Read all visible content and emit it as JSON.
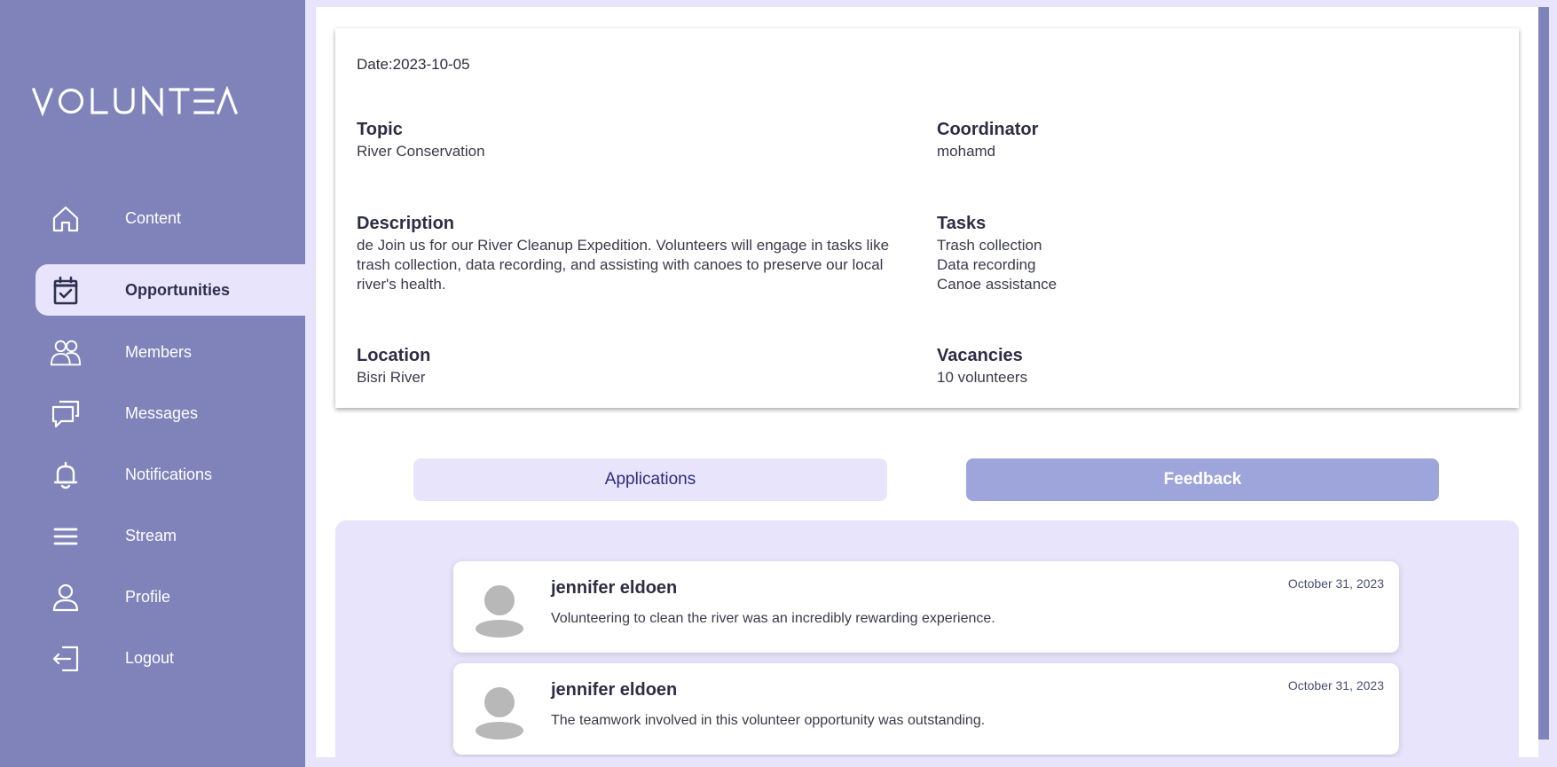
{
  "app": {
    "logo_text": "VOLUNTEA"
  },
  "sidebar": {
    "items": [
      {
        "label": "Content",
        "icon": "home-icon"
      },
      {
        "label": "Opportunities",
        "icon": "calendar-check-icon",
        "active": true
      },
      {
        "label": "Members",
        "icon": "members-icon"
      },
      {
        "label": "Messages",
        "icon": "messages-icon"
      },
      {
        "label": "Notifications",
        "icon": "bell-icon"
      },
      {
        "label": "Stream",
        "icon": "menu-lines-icon"
      },
      {
        "label": "Profile",
        "icon": "user-icon"
      },
      {
        "label": "Logout",
        "icon": "logout-icon"
      }
    ]
  },
  "opportunity": {
    "date": "Date:2023-10-05",
    "topic": {
      "title": "Topic",
      "value": "River Conservation"
    },
    "coordinator": {
      "title": "Coordinator",
      "value": "mohamd"
    },
    "description": {
      "title": "Description",
      "value": "de Join us for our River Cleanup Expedition. Volunteers will engage in tasks like trash collection, data recording, and assisting with canoes to preserve our local river's health."
    },
    "tasks": {
      "title": "Tasks",
      "items": [
        "Trash collection",
        "Data recording",
        "Canoe assistance"
      ]
    },
    "location": {
      "title": "Location",
      "value": "Bisri River"
    },
    "vacancies": {
      "title": "Vacancies",
      "value": "10 volunteers"
    }
  },
  "tabs": {
    "applications": "Applications",
    "feedback": "Feedback"
  },
  "feedback": [
    {
      "name": "jennifer eldoen",
      "date": "October 31, 2023",
      "text": "Volunteering to clean the river was an incredibly rewarding experience."
    },
    {
      "name": "jennifer eldoen",
      "date": "October 31, 2023",
      "text": "The teamwork involved in this volunteer opportunity was outstanding."
    }
  ],
  "colors": {
    "sidebar": "#7f83ba",
    "accent_light": "#e8e4fb",
    "feedback_tab": "#9ea5db"
  }
}
